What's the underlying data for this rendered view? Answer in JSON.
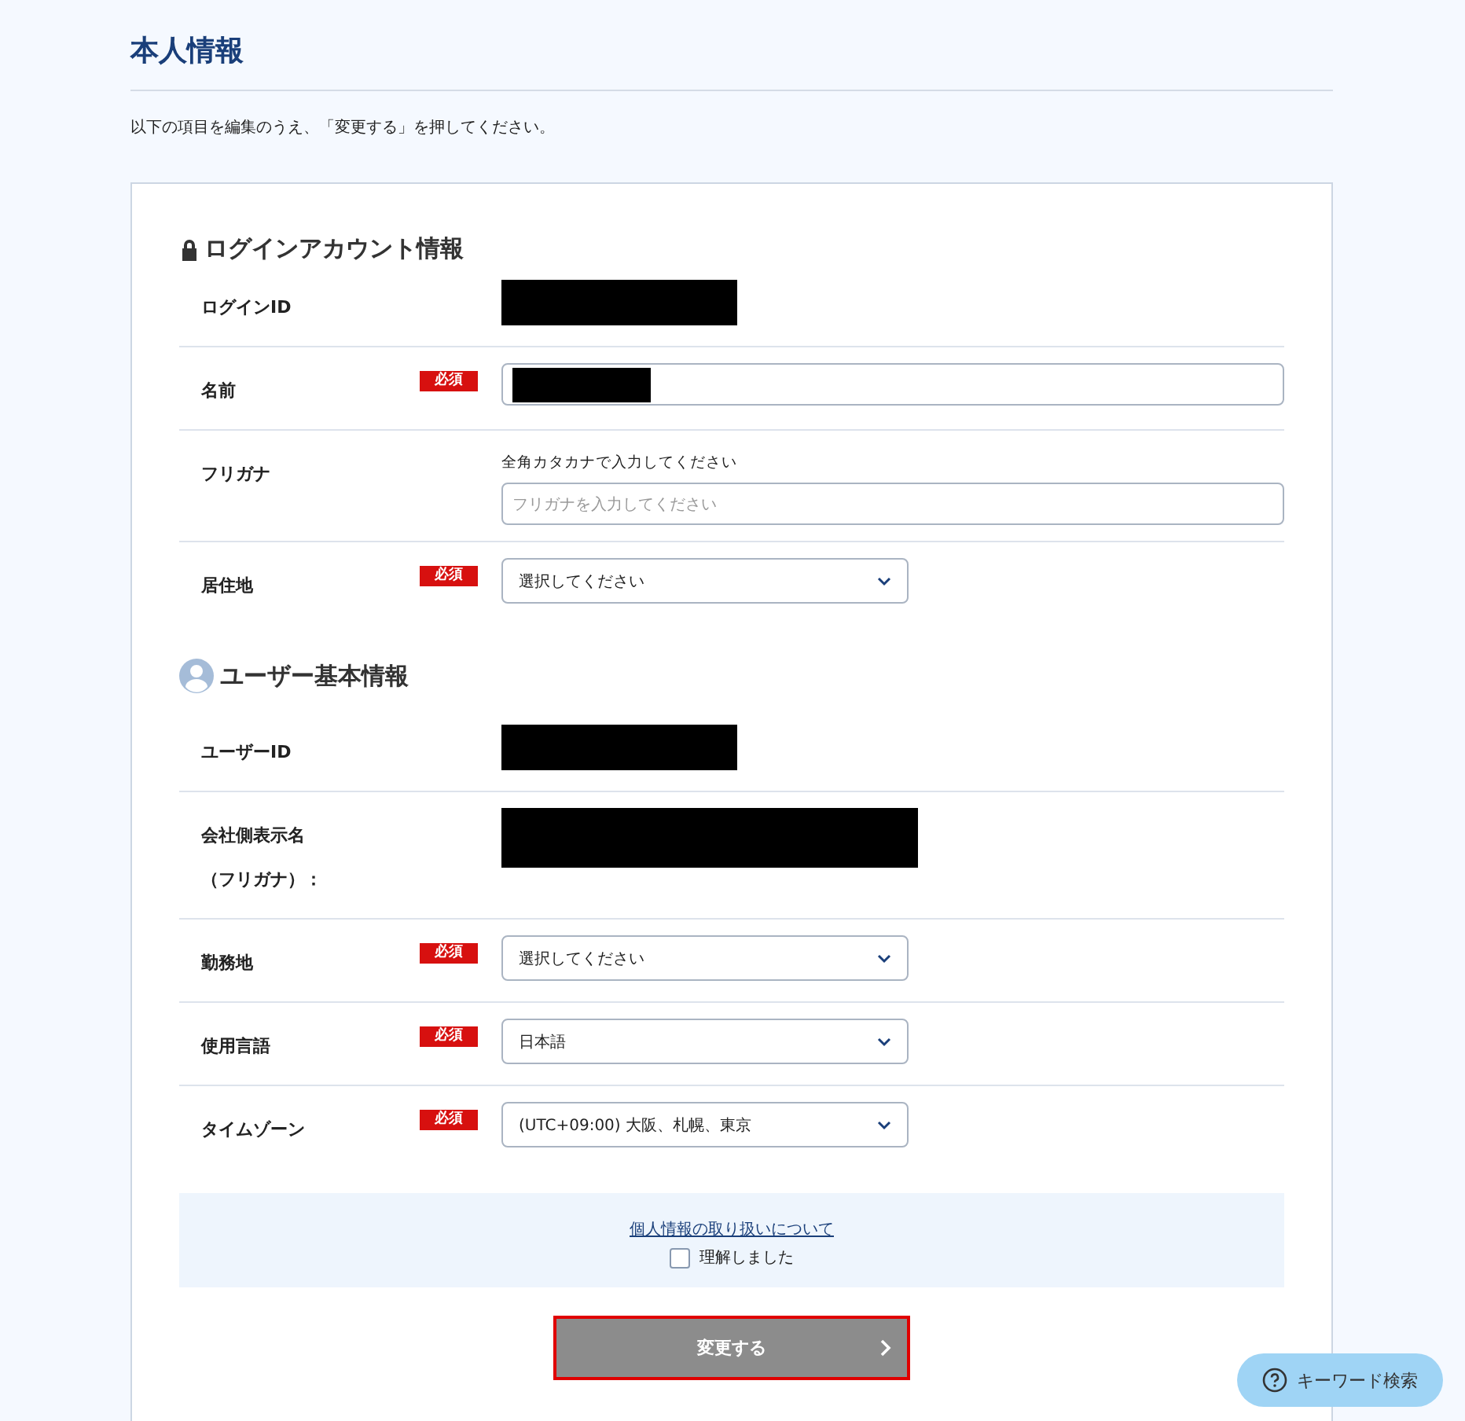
{
  "page": {
    "title": "本人情報",
    "instruction": "以下の項目を編集のうえ、「変更する」を押してください。"
  },
  "sections": [
    {
      "kind": "account",
      "title": "ログインアカウント情報",
      "rows": [
        {
          "label": "ログインID",
          "kind": "redacted"
        },
        {
          "label": "名前",
          "badge": "必須",
          "kind": "input-redacted"
        },
        {
          "label": "フリガナ",
          "kind": "input",
          "hint": "全角カタカナで入力してください",
          "placeholder": "フリガナを入力してください"
        },
        {
          "label": "居住地",
          "badge": "必須",
          "kind": "select",
          "value": "選択してください"
        }
      ]
    },
    {
      "kind": "user",
      "title": "ユーザー基本情報",
      "rows": [
        {
          "label": "ユーザーID",
          "kind": "redacted"
        },
        {
          "label": "会社側表示名（フリガナ）：",
          "kind": "redacted-wide"
        },
        {
          "label": "勤務地",
          "badge": "必須",
          "kind": "select",
          "value": "選択してください"
        },
        {
          "label": "使用言語",
          "badge": "必須",
          "kind": "select",
          "value": "日本語"
        },
        {
          "label": "タイムゾーン",
          "badge": "必須",
          "kind": "select",
          "value": "(UTC+09:00) 大阪、札幌、東京"
        }
      ]
    }
  ],
  "consent": {
    "link": "個人情報の取り扱いについて",
    "checkbox_label": "理解しました",
    "checked": false
  },
  "submit": {
    "label": "変更する",
    "disabled": true,
    "focused": true
  },
  "help_button": {
    "label": "キーワード検索"
  }
}
